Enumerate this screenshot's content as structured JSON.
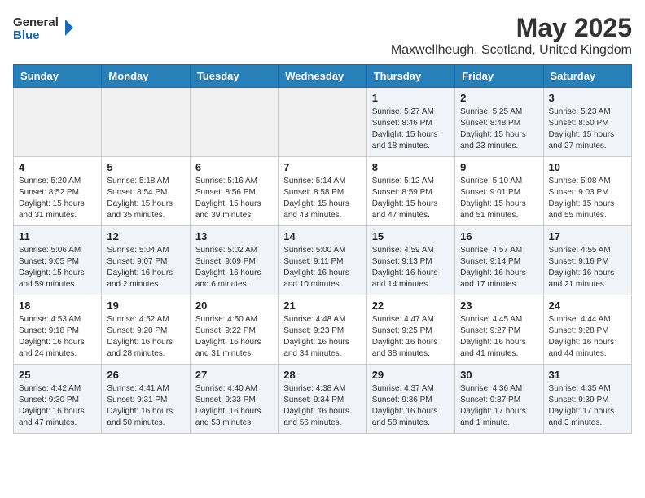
{
  "header": {
    "logo_general": "General",
    "logo_blue": "Blue",
    "month_year": "May 2025",
    "location": "Maxwellheugh, Scotland, United Kingdom"
  },
  "days_of_week": [
    "Sunday",
    "Monday",
    "Tuesday",
    "Wednesday",
    "Thursday",
    "Friday",
    "Saturday"
  ],
  "weeks": [
    {
      "days": [
        {
          "number": "",
          "info": ""
        },
        {
          "number": "",
          "info": ""
        },
        {
          "number": "",
          "info": ""
        },
        {
          "number": "",
          "info": ""
        },
        {
          "number": "1",
          "info": "Sunrise: 5:27 AM\nSunset: 8:46 PM\nDaylight: 15 hours\nand 18 minutes."
        },
        {
          "number": "2",
          "info": "Sunrise: 5:25 AM\nSunset: 8:48 PM\nDaylight: 15 hours\nand 23 minutes."
        },
        {
          "number": "3",
          "info": "Sunrise: 5:23 AM\nSunset: 8:50 PM\nDaylight: 15 hours\nand 27 minutes."
        }
      ]
    },
    {
      "days": [
        {
          "number": "4",
          "info": "Sunrise: 5:20 AM\nSunset: 8:52 PM\nDaylight: 15 hours\nand 31 minutes."
        },
        {
          "number": "5",
          "info": "Sunrise: 5:18 AM\nSunset: 8:54 PM\nDaylight: 15 hours\nand 35 minutes."
        },
        {
          "number": "6",
          "info": "Sunrise: 5:16 AM\nSunset: 8:56 PM\nDaylight: 15 hours\nand 39 minutes."
        },
        {
          "number": "7",
          "info": "Sunrise: 5:14 AM\nSunset: 8:58 PM\nDaylight: 15 hours\nand 43 minutes."
        },
        {
          "number": "8",
          "info": "Sunrise: 5:12 AM\nSunset: 8:59 PM\nDaylight: 15 hours\nand 47 minutes."
        },
        {
          "number": "9",
          "info": "Sunrise: 5:10 AM\nSunset: 9:01 PM\nDaylight: 15 hours\nand 51 minutes."
        },
        {
          "number": "10",
          "info": "Sunrise: 5:08 AM\nSunset: 9:03 PM\nDaylight: 15 hours\nand 55 minutes."
        }
      ]
    },
    {
      "days": [
        {
          "number": "11",
          "info": "Sunrise: 5:06 AM\nSunset: 9:05 PM\nDaylight: 15 hours\nand 59 minutes."
        },
        {
          "number": "12",
          "info": "Sunrise: 5:04 AM\nSunset: 9:07 PM\nDaylight: 16 hours\nand 2 minutes."
        },
        {
          "number": "13",
          "info": "Sunrise: 5:02 AM\nSunset: 9:09 PM\nDaylight: 16 hours\nand 6 minutes."
        },
        {
          "number": "14",
          "info": "Sunrise: 5:00 AM\nSunset: 9:11 PM\nDaylight: 16 hours\nand 10 minutes."
        },
        {
          "number": "15",
          "info": "Sunrise: 4:59 AM\nSunset: 9:13 PM\nDaylight: 16 hours\nand 14 minutes."
        },
        {
          "number": "16",
          "info": "Sunrise: 4:57 AM\nSunset: 9:14 PM\nDaylight: 16 hours\nand 17 minutes."
        },
        {
          "number": "17",
          "info": "Sunrise: 4:55 AM\nSunset: 9:16 PM\nDaylight: 16 hours\nand 21 minutes."
        }
      ]
    },
    {
      "days": [
        {
          "number": "18",
          "info": "Sunrise: 4:53 AM\nSunset: 9:18 PM\nDaylight: 16 hours\nand 24 minutes."
        },
        {
          "number": "19",
          "info": "Sunrise: 4:52 AM\nSunset: 9:20 PM\nDaylight: 16 hours\nand 28 minutes."
        },
        {
          "number": "20",
          "info": "Sunrise: 4:50 AM\nSunset: 9:22 PM\nDaylight: 16 hours\nand 31 minutes."
        },
        {
          "number": "21",
          "info": "Sunrise: 4:48 AM\nSunset: 9:23 PM\nDaylight: 16 hours\nand 34 minutes."
        },
        {
          "number": "22",
          "info": "Sunrise: 4:47 AM\nSunset: 9:25 PM\nDaylight: 16 hours\nand 38 minutes."
        },
        {
          "number": "23",
          "info": "Sunrise: 4:45 AM\nSunset: 9:27 PM\nDaylight: 16 hours\nand 41 minutes."
        },
        {
          "number": "24",
          "info": "Sunrise: 4:44 AM\nSunset: 9:28 PM\nDaylight: 16 hours\nand 44 minutes."
        }
      ]
    },
    {
      "days": [
        {
          "number": "25",
          "info": "Sunrise: 4:42 AM\nSunset: 9:30 PM\nDaylight: 16 hours\nand 47 minutes."
        },
        {
          "number": "26",
          "info": "Sunrise: 4:41 AM\nSunset: 9:31 PM\nDaylight: 16 hours\nand 50 minutes."
        },
        {
          "number": "27",
          "info": "Sunrise: 4:40 AM\nSunset: 9:33 PM\nDaylight: 16 hours\nand 53 minutes."
        },
        {
          "number": "28",
          "info": "Sunrise: 4:38 AM\nSunset: 9:34 PM\nDaylight: 16 hours\nand 56 minutes."
        },
        {
          "number": "29",
          "info": "Sunrise: 4:37 AM\nSunset: 9:36 PM\nDaylight: 16 hours\nand 58 minutes."
        },
        {
          "number": "30",
          "info": "Sunrise: 4:36 AM\nSunset: 9:37 PM\nDaylight: 17 hours\nand 1 minute."
        },
        {
          "number": "31",
          "info": "Sunrise: 4:35 AM\nSunset: 9:39 PM\nDaylight: 17 hours\nand 3 minutes."
        }
      ]
    }
  ]
}
